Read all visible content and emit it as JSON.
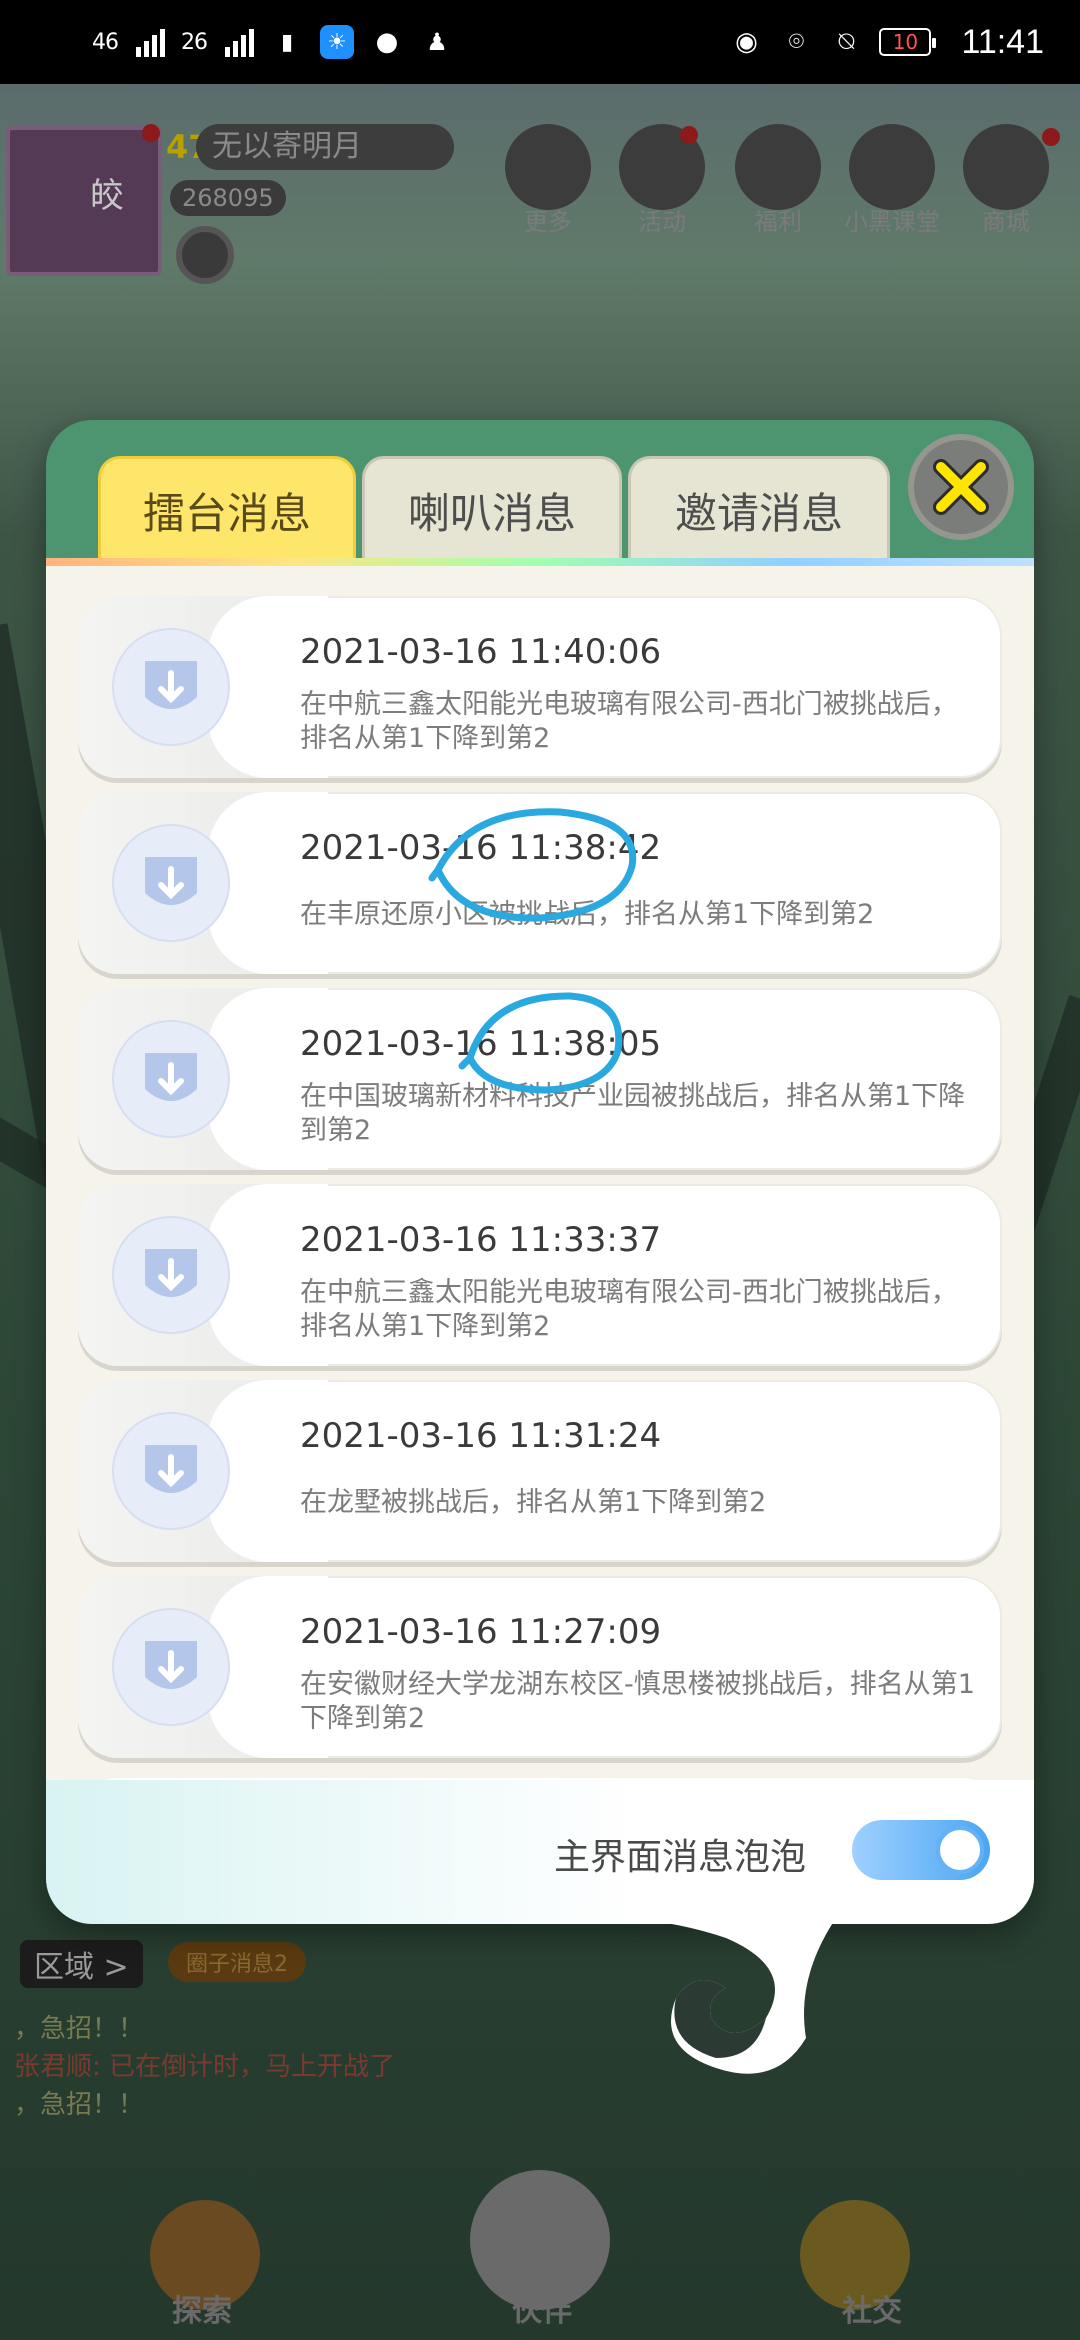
{
  "status_bar": {
    "net1": "46",
    "net2": "26",
    "battery": "10",
    "time": "11:41",
    "icons": [
      "sim-icon",
      "bulb-notification-icon",
      "message-icon",
      "qq-penguin-icon",
      "eye-icon",
      "location-icon",
      "bell-off-icon",
      "battery-icon"
    ]
  },
  "background": {
    "level": "47",
    "nickname": "无以寄明月",
    "coins": "268095",
    "avatar_char": "皎",
    "menu": [
      "更多",
      "活动",
      "福利",
      "小黑课堂",
      "商城"
    ],
    "region_label": "区域 >",
    "group_label": "圈子消息2",
    "chat_lines": [
      "，急招！！",
      "张君顺: 已在倒计时，马上开战了",
      "，急招！！"
    ],
    "bottom_nav": [
      "探索",
      "伙伴",
      "社交"
    ]
  },
  "modal": {
    "tabs": [
      {
        "label": "擂台消息",
        "active": true
      },
      {
        "label": "喇叭消息",
        "active": false
      },
      {
        "label": "邀请消息",
        "active": false
      }
    ],
    "close_icon": "close-x-icon",
    "messages": [
      {
        "time": "2021-03-16 11:40:06",
        "text": "在中航三鑫太阳能光电玻璃有限公司-西北门被挑战后，排名从第1下降到第2"
      },
      {
        "time": "2021-03-16 11:38:42",
        "text": "在丰原还原小区被挑战后，排名从第1下降到第2"
      },
      {
        "time": "2021-03-16 11:38:05",
        "text": "在中国玻璃新材料科技产业园被挑战后，排名从第1下降到第2"
      },
      {
        "time": "2021-03-16 11:33:37",
        "text": "在中航三鑫太阳能光电玻璃有限公司-西北门被挑战后，排名从第1下降到第2"
      },
      {
        "time": "2021-03-16 11:31:24",
        "text": "在龙墅被挑战后，排名从第1下降到第2"
      },
      {
        "time": "2021-03-16 11:27:09",
        "text": "在安徽财经大学龙湖东校区-慎思楼被挑战后，排名从第1下降到第2"
      }
    ],
    "footer_label": "主界面消息泡泡",
    "toggle_on": true
  },
  "colors": {
    "active_tab": "#fde66a",
    "toggle": "#4aa6f2",
    "annotation": "#2aa8e0"
  }
}
